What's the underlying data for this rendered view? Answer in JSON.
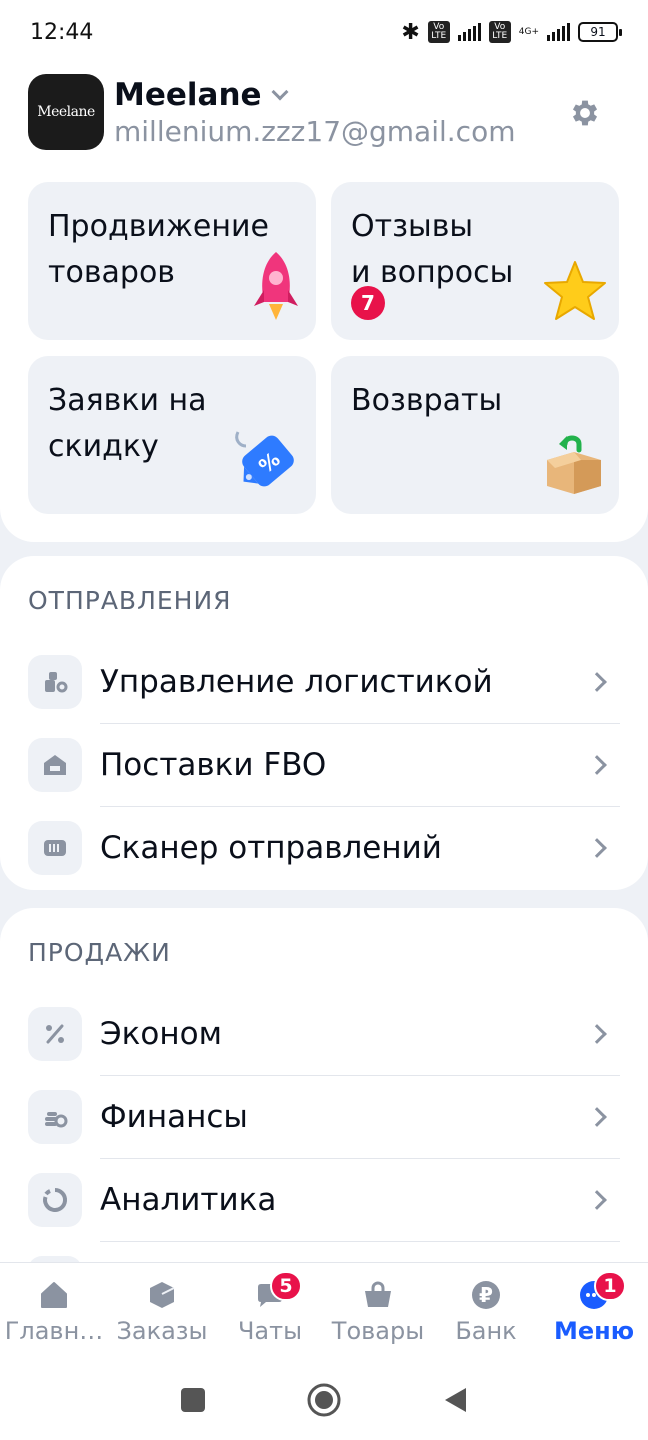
{
  "status_bar": {
    "time": "12:44",
    "battery": "91",
    "net": "4G+",
    "volte": "Vo LTE"
  },
  "account": {
    "logo_text": "Meelane",
    "name": "Meelane",
    "email": "millenium.zzz17@gmail.com"
  },
  "tiles": [
    {
      "label": "Продвижение\nтоваров",
      "icon": "rocket-icon"
    },
    {
      "label": "Отзывы\nи вопросы",
      "badge": "7",
      "icon": "star-icon"
    },
    {
      "label": "Заявки на\nскидку",
      "icon": "discount-tag-icon"
    },
    {
      "label": "Возвраты",
      "icon": "return-box-icon"
    }
  ],
  "shipments": {
    "title": "ОТПРАВЛЕНИЯ",
    "items": [
      {
        "label": "Управление логистикой",
        "icon": "logistics-icon"
      },
      {
        "label": "Поставки FBO",
        "icon": "warehouse-icon"
      },
      {
        "label": "Сканер отправлений",
        "icon": "barcode-scanner-icon"
      }
    ]
  },
  "sales": {
    "title": "ПРОДАЖИ",
    "items": [
      {
        "label": "Эконом",
        "icon": "percent-icon"
      },
      {
        "label": "Финансы",
        "icon": "coins-icon"
      },
      {
        "label": "Аналитика",
        "icon": "analytics-icon"
      }
    ]
  },
  "bottom_nav": [
    {
      "label": "Главн…",
      "icon": "home-icon"
    },
    {
      "label": "Заказы",
      "icon": "orders-icon"
    },
    {
      "label": "Чаты",
      "icon": "chat-icon",
      "badge": "5"
    },
    {
      "label": "Товары",
      "icon": "basket-icon"
    },
    {
      "label": "Банк",
      "icon": "ruble-icon"
    },
    {
      "label": "Меню",
      "icon": "menu-dots-icon",
      "badge": "1",
      "active": true
    }
  ],
  "colors": {
    "accent": "#1a5cff",
    "badge": "#e8124a",
    "muted": "#8b93a1",
    "background": "#eef1f6"
  }
}
